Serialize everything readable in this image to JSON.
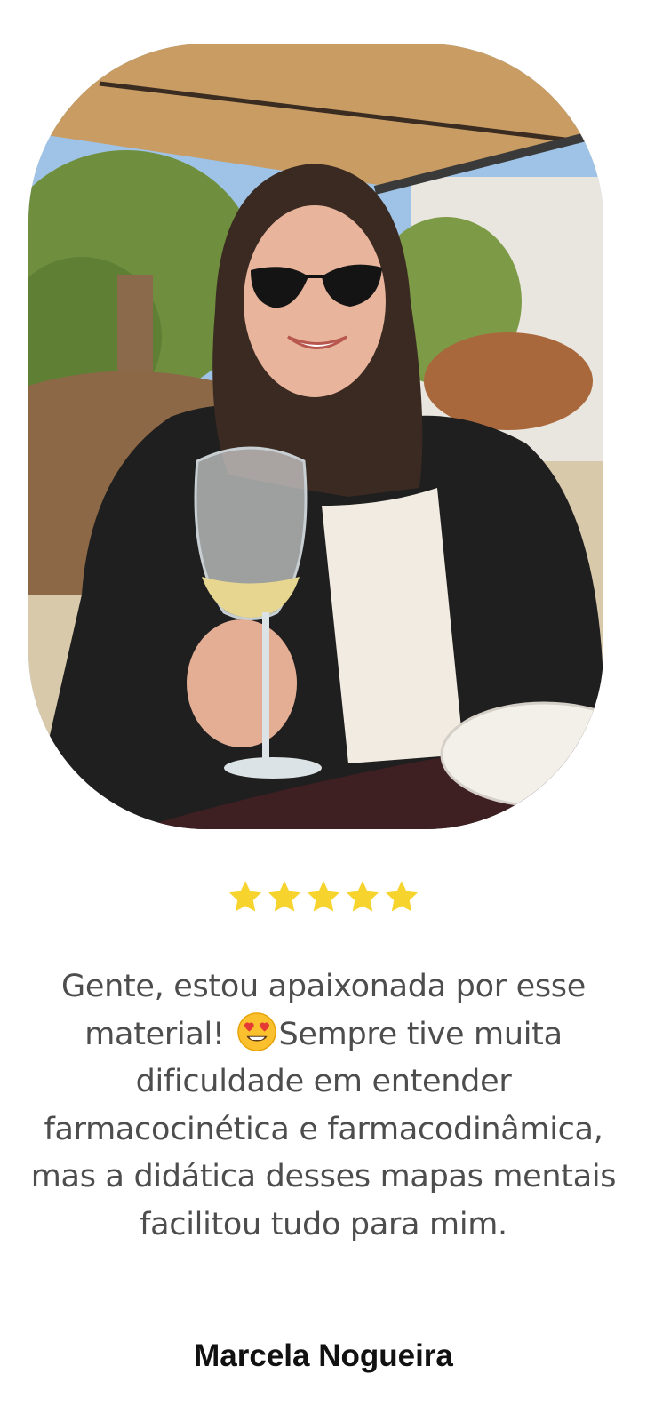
{
  "testimonial": {
    "photo_icon": "customer-photo",
    "rating": 5,
    "rating_max": 5,
    "star_color": "#f6d32d",
    "star_icon": "star-icon",
    "text_before_emoji": "Gente, estou apaixonada por esse material! ",
    "emoji_icon": "heart-eyes-emoji-icon",
    "text_after_emoji": "Sempre tive muita dificuldade em entender farmacocinética e farmacodinâmica, mas a didática desses mapas mentais facilitou tudo para mim.",
    "author": "Marcela Nogueira"
  }
}
